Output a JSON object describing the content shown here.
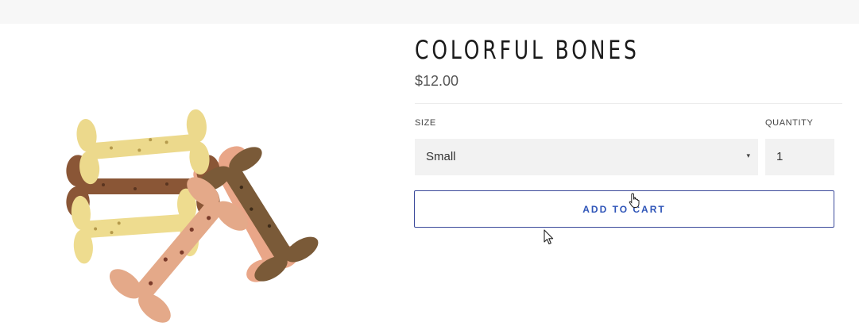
{
  "product": {
    "title": "COLORFUL BONES",
    "price": "$12.00"
  },
  "options": {
    "size_label": "SIZE",
    "size_value": "Small",
    "quantity_label": "QUANTITY",
    "quantity_value": "1"
  },
  "cart": {
    "add_label": "ADD TO CART",
    "button_color": "#3b4a9a",
    "text_color": "#2f55b8"
  },
  "icons": {
    "select_caret": "▾",
    "hand_cursor": "hand-pointer-icon",
    "arrow_cursor": "arrow-pointer-icon"
  },
  "colors": {
    "bone_cream": "#ecd98c",
    "bone_brown": "#8a5636",
    "bone_olive": "#7a5a38",
    "bone_pink": "#e4a989",
    "bone_salmon": "#e9a688"
  }
}
